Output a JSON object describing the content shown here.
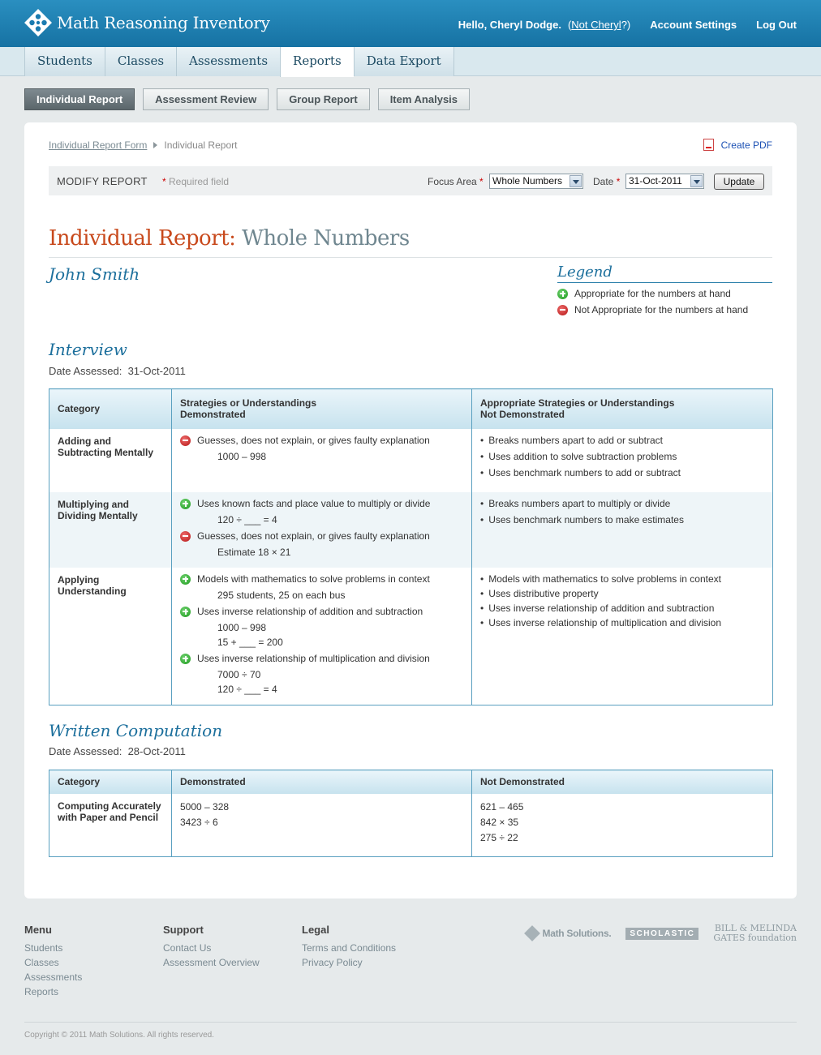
{
  "app": {
    "title": "Math Reasoning Inventory"
  },
  "user": {
    "greeting": "Hello, Cheryl Dodge.",
    "not_user_prefix": "(",
    "not_user_link": "Not Cheryl",
    "not_user_suffix": "?)",
    "account_settings": "Account Settings",
    "logout": "Log Out"
  },
  "nav": {
    "tabs": [
      "Students",
      "Classes",
      "Assessments",
      "Reports",
      "Data Export"
    ],
    "active": "Reports"
  },
  "subnav": {
    "buttons": [
      "Individual Report",
      "Assessment Review",
      "Group Report",
      "Item Analysis"
    ],
    "active": "Individual Report"
  },
  "breadcrumb": {
    "link": "Individual Report Form",
    "current": "Individual Report"
  },
  "pdf_label": "Create PDF",
  "modify": {
    "label": "MODIFY REPORT",
    "required_star": "*",
    "required_text": "Required field",
    "focus_label": "Focus Area",
    "focus_value": "Whole Numbers",
    "date_label": "Date",
    "date_value": "31-Oct-2011",
    "update_label": "Update"
  },
  "report": {
    "title_prefix": "Individual Report:",
    "title_focus": "Whole Numbers",
    "student": "John Smith"
  },
  "legend": {
    "title": "Legend",
    "appropriate": "Appropriate for the numbers at hand",
    "not_appropriate": "Not Appropriate for the numbers at hand"
  },
  "interview": {
    "title": "Interview",
    "date_label": "Date Assessed:",
    "date": "31-Oct-2011",
    "headers": {
      "category": "Category",
      "demonstrated_1": "Strategies or Understandings",
      "demonstrated_2": "Demonstrated",
      "not_demonstrated_1": "Appropriate Strategies or Understandings",
      "not_demonstrated_2": "Not Demonstrated"
    },
    "rows": [
      {
        "category_1": "Adding and",
        "category_2": "Subtracting Mentally",
        "demonstrated": [
          {
            "type": "minus",
            "text": "Guesses, does not explain, or gives faulty explanation",
            "examples": [
              "1000 – 998"
            ]
          }
        ],
        "not_demonstrated": [
          "Breaks numbers apart to add or subtract",
          "Uses addition to solve subtraction problems",
          "Uses benchmark numbers to add or subtract"
        ]
      },
      {
        "category_1": "Multiplying and",
        "category_2": "Dividing Mentally",
        "demonstrated": [
          {
            "type": "plus",
            "text": "Uses known facts and place value to multiply or divide",
            "examples": [
              "120 ÷ ___ = 4"
            ]
          },
          {
            "type": "minus",
            "text": "Guesses, does not explain, or gives faulty explanation",
            "examples": [
              "Estimate 18 × 21"
            ]
          }
        ],
        "not_demonstrated": [
          "Breaks numbers apart to multiply or divide",
          "Uses benchmark numbers to make estimates"
        ]
      },
      {
        "category_1": "Applying",
        "category_2": "Understanding",
        "demonstrated": [
          {
            "type": "plus",
            "text": "Models with mathematics to solve problems in context",
            "examples": [
              "295 students, 25 on each bus"
            ]
          },
          {
            "type": "plus",
            "text": "Uses inverse relationship of addition and subtraction",
            "examples": [
              "1000 – 998",
              "15 + ___ = 200"
            ]
          },
          {
            "type": "plus",
            "text": "Uses inverse relationship of multiplication and division",
            "examples": [
              "7000 ÷ 70",
              "120 ÷ ___ = 4"
            ]
          }
        ],
        "not_demonstrated": [
          "Models with mathematics to solve problems in context",
          "Uses distributive property",
          "Uses inverse relationship of addition and subtraction",
          "Uses inverse relationship of multiplication and division"
        ]
      }
    ]
  },
  "written": {
    "title": "Written Computation",
    "date_label": "Date Assessed:",
    "date": "28-Oct-2011",
    "headers": {
      "category": "Category",
      "demonstrated": "Demonstrated",
      "not_demonstrated": "Not Demonstrated"
    },
    "row": {
      "category_1": "Computing Accurately",
      "category_2": "with Paper and Pencil",
      "demonstrated": [
        "5000 – 328",
        "3423 ÷ 6"
      ],
      "not_demonstrated": [
        "621 – 465",
        "842 × 35",
        "275 ÷ 22"
      ]
    }
  },
  "footer": {
    "menu_title": "Menu",
    "menu": [
      "Students",
      "Classes",
      "Assessments",
      "Reports"
    ],
    "support_title": "Support",
    "support": [
      "Contact Us",
      "Assessment Overview"
    ],
    "legal_title": "Legal",
    "legal": [
      "Terms and Conditions",
      "Privacy Policy"
    ],
    "partner_1": "Math Solutions.",
    "partner_2": "SCHOLASTIC",
    "partner_3_line1": "BILL & MELINDA",
    "partner_3_line2": "GATES foundation",
    "copyright": "Copyright © 2011 Math Solutions. All rights reserved."
  }
}
